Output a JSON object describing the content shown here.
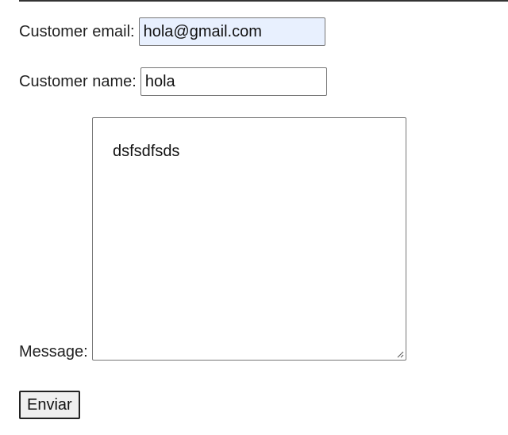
{
  "form": {
    "email": {
      "label": "Customer email:",
      "value": "hola@gmail.com"
    },
    "name": {
      "label": "Customer name:",
      "value": "hola"
    },
    "message": {
      "label": "Message:",
      "value": "dsfsdfsds"
    },
    "submit_label": "Enviar"
  },
  "colors": {
    "autofill_background": "#e8f0fe",
    "border": "#767676",
    "button_background": "#efefef"
  }
}
